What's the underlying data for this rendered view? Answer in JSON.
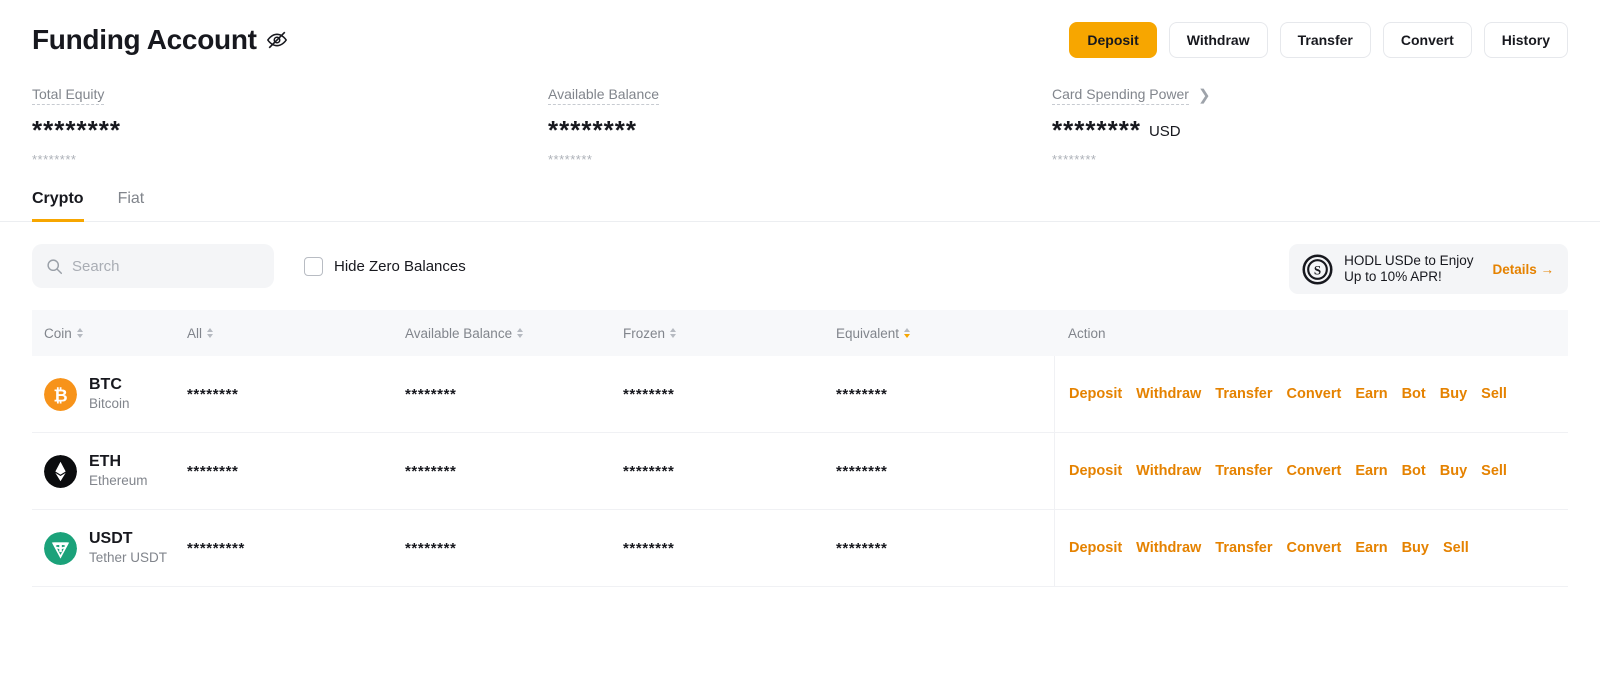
{
  "header": {
    "title": "Funding Account",
    "visibility_icon": "eye-off-icon",
    "buttons": [
      {
        "label": "Deposit",
        "primary": true
      },
      {
        "label": "Withdraw",
        "primary": false
      },
      {
        "label": "Transfer",
        "primary": false
      },
      {
        "label": "Convert",
        "primary": false
      },
      {
        "label": "History",
        "primary": false
      }
    ]
  },
  "summary": [
    {
      "label": "Total Equity",
      "value": "********",
      "sub": "********",
      "unit": "",
      "has_chevron": false
    },
    {
      "label": "Available Balance",
      "value": "********",
      "sub": "********",
      "unit": "",
      "has_chevron": false
    },
    {
      "label": "Card Spending Power",
      "value": "********",
      "sub": "********",
      "unit": "USD",
      "has_chevron": true
    }
  ],
  "tabs": [
    {
      "label": "Crypto",
      "active": true
    },
    {
      "label": "Fiat",
      "active": false
    }
  ],
  "filters": {
    "search_placeholder": "Search",
    "search_value": "",
    "search_icon": "search-icon",
    "hide_zero_label": "Hide Zero Balances",
    "hide_zero_checked": false
  },
  "promo": {
    "icon": "dollar-coin-icon",
    "line1": "HODL USDe to Enjoy",
    "line2": "Up to 10% APR!",
    "link": "Details →"
  },
  "table": {
    "columns": [
      {
        "label": "Coin",
        "sortable": true,
        "sort": "none"
      },
      {
        "label": "All",
        "sortable": true,
        "sort": "none"
      },
      {
        "label": "Available Balance",
        "sortable": true,
        "sort": "none"
      },
      {
        "label": "Frozen",
        "sortable": true,
        "sort": "none"
      },
      {
        "label": "Equivalent",
        "sortable": true,
        "sort": "desc"
      },
      {
        "label": "Action",
        "sortable": false,
        "sort": "none"
      }
    ],
    "rows": [
      {
        "symbol": "BTC",
        "name": "Bitcoin",
        "icon": "btc-icon",
        "color": "#f7931a",
        "all": "********",
        "available": "********",
        "frozen": "********",
        "equivalent": "********",
        "actions": [
          "Deposit",
          "Withdraw",
          "Transfer",
          "Convert",
          "Earn",
          "Bot",
          "Buy",
          "Sell"
        ]
      },
      {
        "symbol": "ETH",
        "name": "Ethereum",
        "icon": "eth-icon",
        "color": "#0b0c0e",
        "all": "********",
        "available": "********",
        "frozen": "********",
        "equivalent": "********",
        "actions": [
          "Deposit",
          "Withdraw",
          "Transfer",
          "Convert",
          "Earn",
          "Bot",
          "Buy",
          "Sell"
        ]
      },
      {
        "symbol": "USDT",
        "name": "Tether USDT",
        "icon": "usdt-icon",
        "color": "#1ba27a",
        "all": "*********",
        "available": "********",
        "frozen": "********",
        "equivalent": "********",
        "actions": [
          "Deposit",
          "Withdraw",
          "Transfer",
          "Convert",
          "Earn",
          "Buy",
          "Sell"
        ]
      }
    ]
  },
  "colors": {
    "accent": "#f7a600",
    "link": "#e58200",
    "text": "#17181e",
    "muted": "#81858c",
    "surface": "#f4f5f7"
  }
}
